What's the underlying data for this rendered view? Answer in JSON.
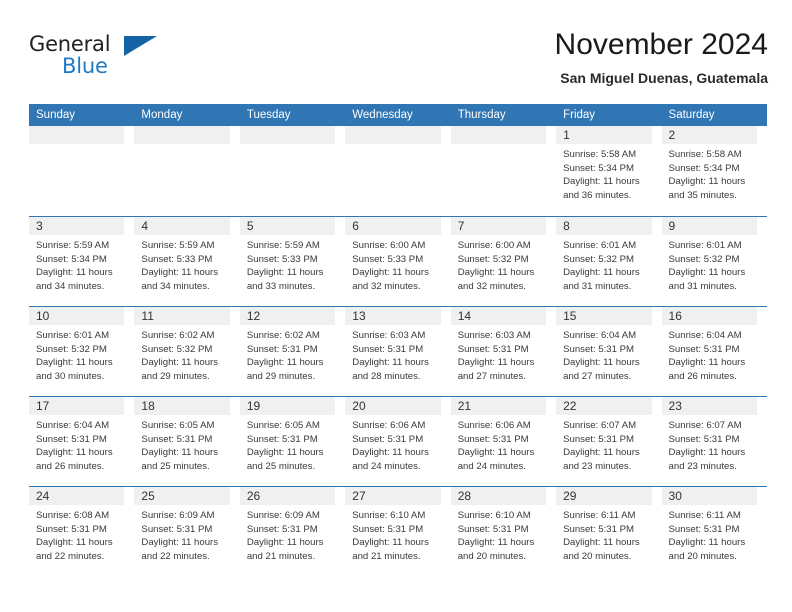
{
  "brand": {
    "name_top": "General",
    "name_bottom": "Blue",
    "triangle_icon": "triangle-icon",
    "color_dark": "#231f20",
    "color_blue": "#1f7ac4"
  },
  "header": {
    "title": "November 2024",
    "subtitle": "San Miguel Duenas, Guatemala"
  },
  "theme": {
    "header_blue": "#3075b4",
    "day_band_gray": "#f0f0f0",
    "text": "#3a3a3a"
  },
  "calendar": {
    "weekdays": [
      "Sunday",
      "Monday",
      "Tuesday",
      "Wednesday",
      "Thursday",
      "Friday",
      "Saturday"
    ],
    "labels": {
      "sunrise": "Sunrise:",
      "sunset": "Sunset:",
      "daylight": "Daylight:"
    },
    "weeks": [
      [
        {
          "blank": true
        },
        {
          "blank": true
        },
        {
          "blank": true
        },
        {
          "blank": true
        },
        {
          "blank": true
        },
        {
          "day": "1",
          "sunrise": "Sunrise: 5:58 AM",
          "sunset": "Sunset: 5:34 PM",
          "daylight_1": "Daylight: 11 hours",
          "daylight_2": "and 36 minutes."
        },
        {
          "day": "2",
          "sunrise": "Sunrise: 5:58 AM",
          "sunset": "Sunset: 5:34 PM",
          "daylight_1": "Daylight: 11 hours",
          "daylight_2": "and 35 minutes."
        }
      ],
      [
        {
          "day": "3",
          "sunrise": "Sunrise: 5:59 AM",
          "sunset": "Sunset: 5:34 PM",
          "daylight_1": "Daylight: 11 hours",
          "daylight_2": "and 34 minutes."
        },
        {
          "day": "4",
          "sunrise": "Sunrise: 5:59 AM",
          "sunset": "Sunset: 5:33 PM",
          "daylight_1": "Daylight: 11 hours",
          "daylight_2": "and 34 minutes."
        },
        {
          "day": "5",
          "sunrise": "Sunrise: 5:59 AM",
          "sunset": "Sunset: 5:33 PM",
          "daylight_1": "Daylight: 11 hours",
          "daylight_2": "and 33 minutes."
        },
        {
          "day": "6",
          "sunrise": "Sunrise: 6:00 AM",
          "sunset": "Sunset: 5:33 PM",
          "daylight_1": "Daylight: 11 hours",
          "daylight_2": "and 32 minutes."
        },
        {
          "day": "7",
          "sunrise": "Sunrise: 6:00 AM",
          "sunset": "Sunset: 5:32 PM",
          "daylight_1": "Daylight: 11 hours",
          "daylight_2": "and 32 minutes."
        },
        {
          "day": "8",
          "sunrise": "Sunrise: 6:01 AM",
          "sunset": "Sunset: 5:32 PM",
          "daylight_1": "Daylight: 11 hours",
          "daylight_2": "and 31 minutes."
        },
        {
          "day": "9",
          "sunrise": "Sunrise: 6:01 AM",
          "sunset": "Sunset: 5:32 PM",
          "daylight_1": "Daylight: 11 hours",
          "daylight_2": "and 31 minutes."
        }
      ],
      [
        {
          "day": "10",
          "sunrise": "Sunrise: 6:01 AM",
          "sunset": "Sunset: 5:32 PM",
          "daylight_1": "Daylight: 11 hours",
          "daylight_2": "and 30 minutes."
        },
        {
          "day": "11",
          "sunrise": "Sunrise: 6:02 AM",
          "sunset": "Sunset: 5:32 PM",
          "daylight_1": "Daylight: 11 hours",
          "daylight_2": "and 29 minutes."
        },
        {
          "day": "12",
          "sunrise": "Sunrise: 6:02 AM",
          "sunset": "Sunset: 5:31 PM",
          "daylight_1": "Daylight: 11 hours",
          "daylight_2": "and 29 minutes."
        },
        {
          "day": "13",
          "sunrise": "Sunrise: 6:03 AM",
          "sunset": "Sunset: 5:31 PM",
          "daylight_1": "Daylight: 11 hours",
          "daylight_2": "and 28 minutes."
        },
        {
          "day": "14",
          "sunrise": "Sunrise: 6:03 AM",
          "sunset": "Sunset: 5:31 PM",
          "daylight_1": "Daylight: 11 hours",
          "daylight_2": "and 27 minutes."
        },
        {
          "day": "15",
          "sunrise": "Sunrise: 6:04 AM",
          "sunset": "Sunset: 5:31 PM",
          "daylight_1": "Daylight: 11 hours",
          "daylight_2": "and 27 minutes."
        },
        {
          "day": "16",
          "sunrise": "Sunrise: 6:04 AM",
          "sunset": "Sunset: 5:31 PM",
          "daylight_1": "Daylight: 11 hours",
          "daylight_2": "and 26 minutes."
        }
      ],
      [
        {
          "day": "17",
          "sunrise": "Sunrise: 6:04 AM",
          "sunset": "Sunset: 5:31 PM",
          "daylight_1": "Daylight: 11 hours",
          "daylight_2": "and 26 minutes."
        },
        {
          "day": "18",
          "sunrise": "Sunrise: 6:05 AM",
          "sunset": "Sunset: 5:31 PM",
          "daylight_1": "Daylight: 11 hours",
          "daylight_2": "and 25 minutes."
        },
        {
          "day": "19",
          "sunrise": "Sunrise: 6:05 AM",
          "sunset": "Sunset: 5:31 PM",
          "daylight_1": "Daylight: 11 hours",
          "daylight_2": "and 25 minutes."
        },
        {
          "day": "20",
          "sunrise": "Sunrise: 6:06 AM",
          "sunset": "Sunset: 5:31 PM",
          "daylight_1": "Daylight: 11 hours",
          "daylight_2": "and 24 minutes."
        },
        {
          "day": "21",
          "sunrise": "Sunrise: 6:06 AM",
          "sunset": "Sunset: 5:31 PM",
          "daylight_1": "Daylight: 11 hours",
          "daylight_2": "and 24 minutes."
        },
        {
          "day": "22",
          "sunrise": "Sunrise: 6:07 AM",
          "sunset": "Sunset: 5:31 PM",
          "daylight_1": "Daylight: 11 hours",
          "daylight_2": "and 23 minutes."
        },
        {
          "day": "23",
          "sunrise": "Sunrise: 6:07 AM",
          "sunset": "Sunset: 5:31 PM",
          "daylight_1": "Daylight: 11 hours",
          "daylight_2": "and 23 minutes."
        }
      ],
      [
        {
          "day": "24",
          "sunrise": "Sunrise: 6:08 AM",
          "sunset": "Sunset: 5:31 PM",
          "daylight_1": "Daylight: 11 hours",
          "daylight_2": "and 22 minutes."
        },
        {
          "day": "25",
          "sunrise": "Sunrise: 6:09 AM",
          "sunset": "Sunset: 5:31 PM",
          "daylight_1": "Daylight: 11 hours",
          "daylight_2": "and 22 minutes."
        },
        {
          "day": "26",
          "sunrise": "Sunrise: 6:09 AM",
          "sunset": "Sunset: 5:31 PM",
          "daylight_1": "Daylight: 11 hours",
          "daylight_2": "and 21 minutes."
        },
        {
          "day": "27",
          "sunrise": "Sunrise: 6:10 AM",
          "sunset": "Sunset: 5:31 PM",
          "daylight_1": "Daylight: 11 hours",
          "daylight_2": "and 21 minutes."
        },
        {
          "day": "28",
          "sunrise": "Sunrise: 6:10 AM",
          "sunset": "Sunset: 5:31 PM",
          "daylight_1": "Daylight: 11 hours",
          "daylight_2": "and 20 minutes."
        },
        {
          "day": "29",
          "sunrise": "Sunrise: 6:11 AM",
          "sunset": "Sunset: 5:31 PM",
          "daylight_1": "Daylight: 11 hours",
          "daylight_2": "and 20 minutes."
        },
        {
          "day": "30",
          "sunrise": "Sunrise: 6:11 AM",
          "sunset": "Sunset: 5:31 PM",
          "daylight_1": "Daylight: 11 hours",
          "daylight_2": "and 20 minutes."
        }
      ]
    ]
  }
}
